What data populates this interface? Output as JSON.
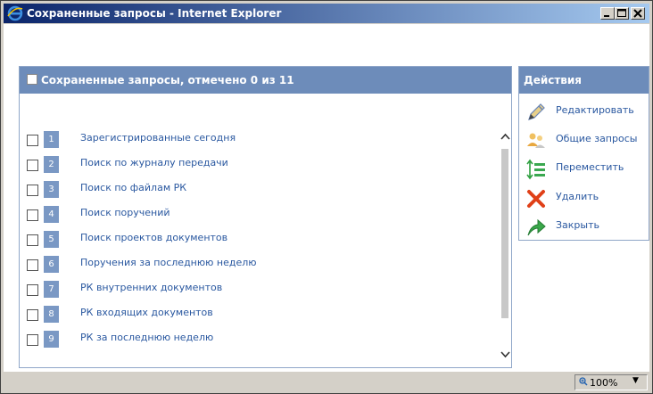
{
  "window": {
    "title": "Сохраненные запросы - Internet Explorer"
  },
  "panel": {
    "header": "Сохраненные запросы, отмечено 0 из 11",
    "items": [
      {
        "num": "1",
        "label": "Зарегистрированные сегодня",
        "checked": false
      },
      {
        "num": "2",
        "label": "Поиск по журналу передачи",
        "checked": false
      },
      {
        "num": "3",
        "label": "Поиск по файлам РК",
        "checked": false
      },
      {
        "num": "4",
        "label": "Поиск поручений",
        "checked": false
      },
      {
        "num": "5",
        "label": "Поиск проектов документов",
        "checked": false
      },
      {
        "num": "6",
        "label": "Поручения за последнюю неделю",
        "checked": false
      },
      {
        "num": "7",
        "label": "РК внутренних документов",
        "checked": false
      },
      {
        "num": "8",
        "label": "РК входящих документов",
        "checked": false
      },
      {
        "num": "9",
        "label": "РК за последнюю неделю",
        "checked": false
      }
    ]
  },
  "actions": {
    "header": "Действия",
    "items": [
      {
        "label": "Редактировать",
        "icon": "pencil-icon"
      },
      {
        "label": "Общие запросы",
        "icon": "shared-users-icon"
      },
      {
        "label": "Переместить",
        "icon": "move-list-icon"
      },
      {
        "label": "Удалить",
        "icon": "delete-x-icon"
      },
      {
        "label": "Закрыть",
        "icon": "close-arrow-icon"
      }
    ]
  },
  "statusbar": {
    "zoom": "100%"
  },
  "colors": {
    "header_bg": "#6d8cba",
    "number_badge": "#7a98c4",
    "link_text": "#2a58a0"
  }
}
